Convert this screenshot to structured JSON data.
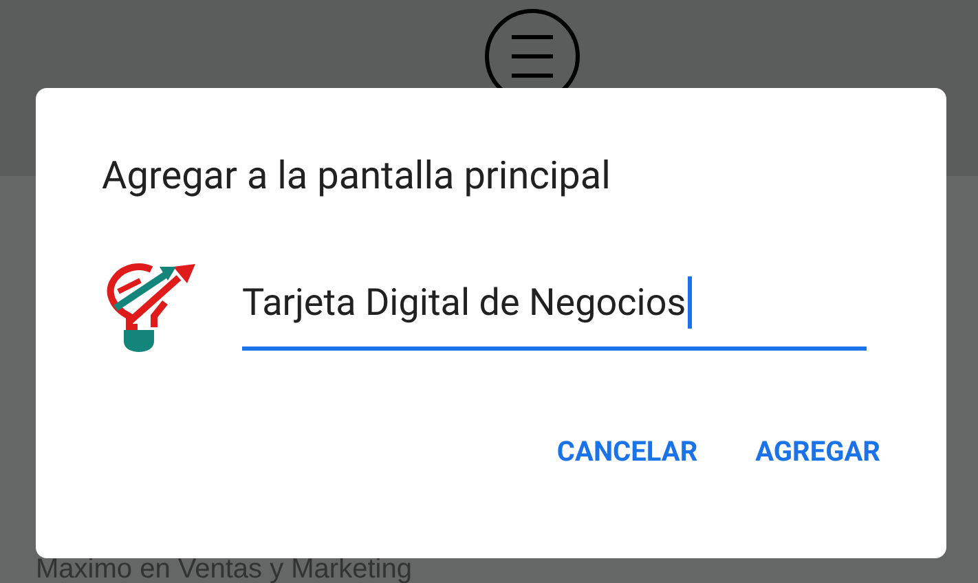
{
  "background": {
    "heading": "Maximo en Ventas y Marketing"
  },
  "dialog": {
    "title": "Agregar a la pantalla principal",
    "name_field": {
      "value": "Tarjeta Digital de Negocios",
      "focused": true
    },
    "buttons": [
      {
        "label": "CANCELAR"
      },
      {
        "label": "AGREGAR"
      }
    ]
  }
}
